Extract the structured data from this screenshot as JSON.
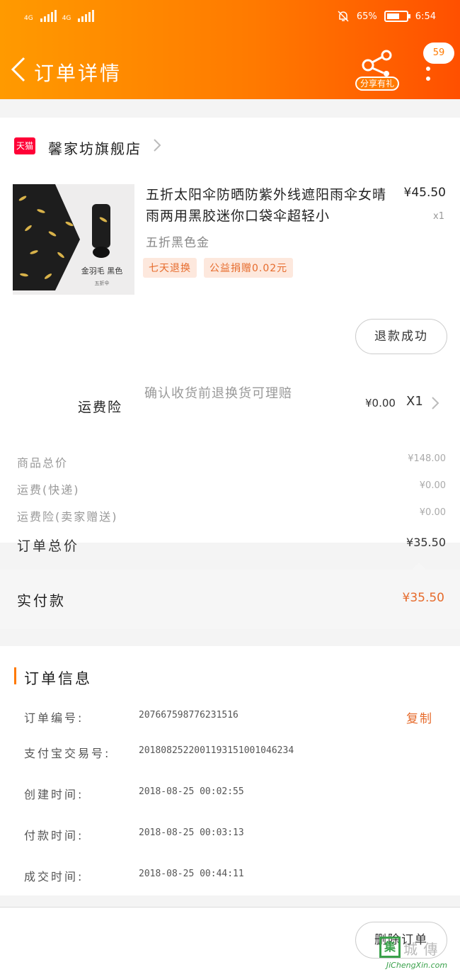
{
  "status_bar": {
    "network1": "4G",
    "network2": "4G",
    "battery_percent": "65%",
    "battery_level": 0.65,
    "time": "6:54"
  },
  "header": {
    "back_icon": "chevron-left-icon",
    "title": "订单详情",
    "share_label": "分享有礼",
    "badge_count": "59",
    "brand_color": "#ff7a00"
  },
  "store": {
    "logo_text": "天猫",
    "name": "馨家坊旗舰店"
  },
  "product": {
    "title": "五折太阳伞防晒防紫外线遮阳雨伞女晴雨两用黑胶迷你口袋伞超轻小",
    "price": "¥45.50",
    "qty": "x1",
    "variant": "五折黑色金",
    "image_caption": "金羽毛 黑色",
    "image_subcaption": "五折伞",
    "tags": [
      "七天退换",
      "公益捐赠0.02元"
    ],
    "refund_button": "退款成功"
  },
  "insurance": {
    "label": "运费险",
    "description": "确认收货前退换货可理赔",
    "price": "¥0.00",
    "qty": "X1"
  },
  "summary": [
    {
      "label": "商品总价",
      "value": "¥148.00"
    },
    {
      "label": "运费(快递)",
      "value": "¥0.00"
    },
    {
      "label": "运费险(卖家赠送)",
      "value": "¥0.00"
    }
  ],
  "order_total": {
    "label": "订单总价",
    "value": "¥35.50"
  },
  "paid": {
    "label": "实付款",
    "value": "¥35.50",
    "color": "#e66b2c"
  },
  "order_info": {
    "title": "订单信息",
    "copy_label": "复制",
    "rows": [
      {
        "label": "订单编号:",
        "value": "207667598776231516"
      },
      {
        "label": "支付宝交易号:",
        "value": "2018082522001193151001046234"
      },
      {
        "label": "创建时间:",
        "value": "2018-08-25 00:02:55"
      },
      {
        "label": "付款时间:",
        "value": "2018-08-25 00:03:13"
      },
      {
        "label": "成交时间:",
        "value": "2018-08-25 00:44:11"
      }
    ]
  },
  "bottom": {
    "delete_button": "删除订单"
  },
  "watermark": {
    "logo": "集",
    "text": "城 傳",
    "sub": "JiChengXin.com"
  }
}
